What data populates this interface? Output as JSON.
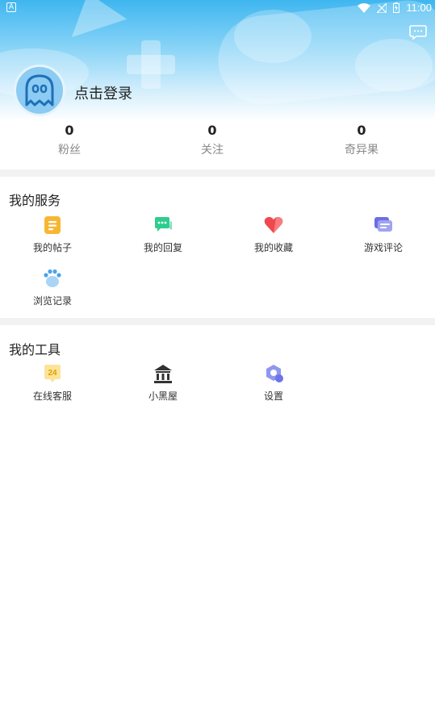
{
  "status_bar": {
    "left_badge": "A",
    "time": "11:00"
  },
  "profile": {
    "login_prompt": "点击登录"
  },
  "stats": [
    {
      "value": "0",
      "label": "粉丝"
    },
    {
      "value": "0",
      "label": "关注"
    },
    {
      "value": "0",
      "label": "奇异果"
    }
  ],
  "services": {
    "title": "我的服务",
    "items": [
      {
        "label": "我的帖子",
        "icon": "post-icon"
      },
      {
        "label": "我的回复",
        "icon": "reply-icon"
      },
      {
        "label": "我的收藏",
        "icon": "heart-icon"
      },
      {
        "label": "游戏评论",
        "icon": "comment-icon"
      },
      {
        "label": "浏览记录",
        "icon": "paw-icon"
      }
    ]
  },
  "tools": {
    "title": "我的工具",
    "items": [
      {
        "label": "在线客服",
        "icon": "support-24-icon",
        "badge": "24"
      },
      {
        "label": "小黑屋",
        "icon": "jail-icon"
      },
      {
        "label": "设置",
        "icon": "settings-icon"
      }
    ]
  },
  "colors": {
    "header_top": "#3fb6f0",
    "post": "#f7b733",
    "reply": "#2ecc8f",
    "heart": "#f0484e",
    "comment": "#6a6fe0",
    "paw": "#4aa3ea",
    "support": "#f7c948",
    "jail": "#333333",
    "settings": "#6a75e8"
  }
}
